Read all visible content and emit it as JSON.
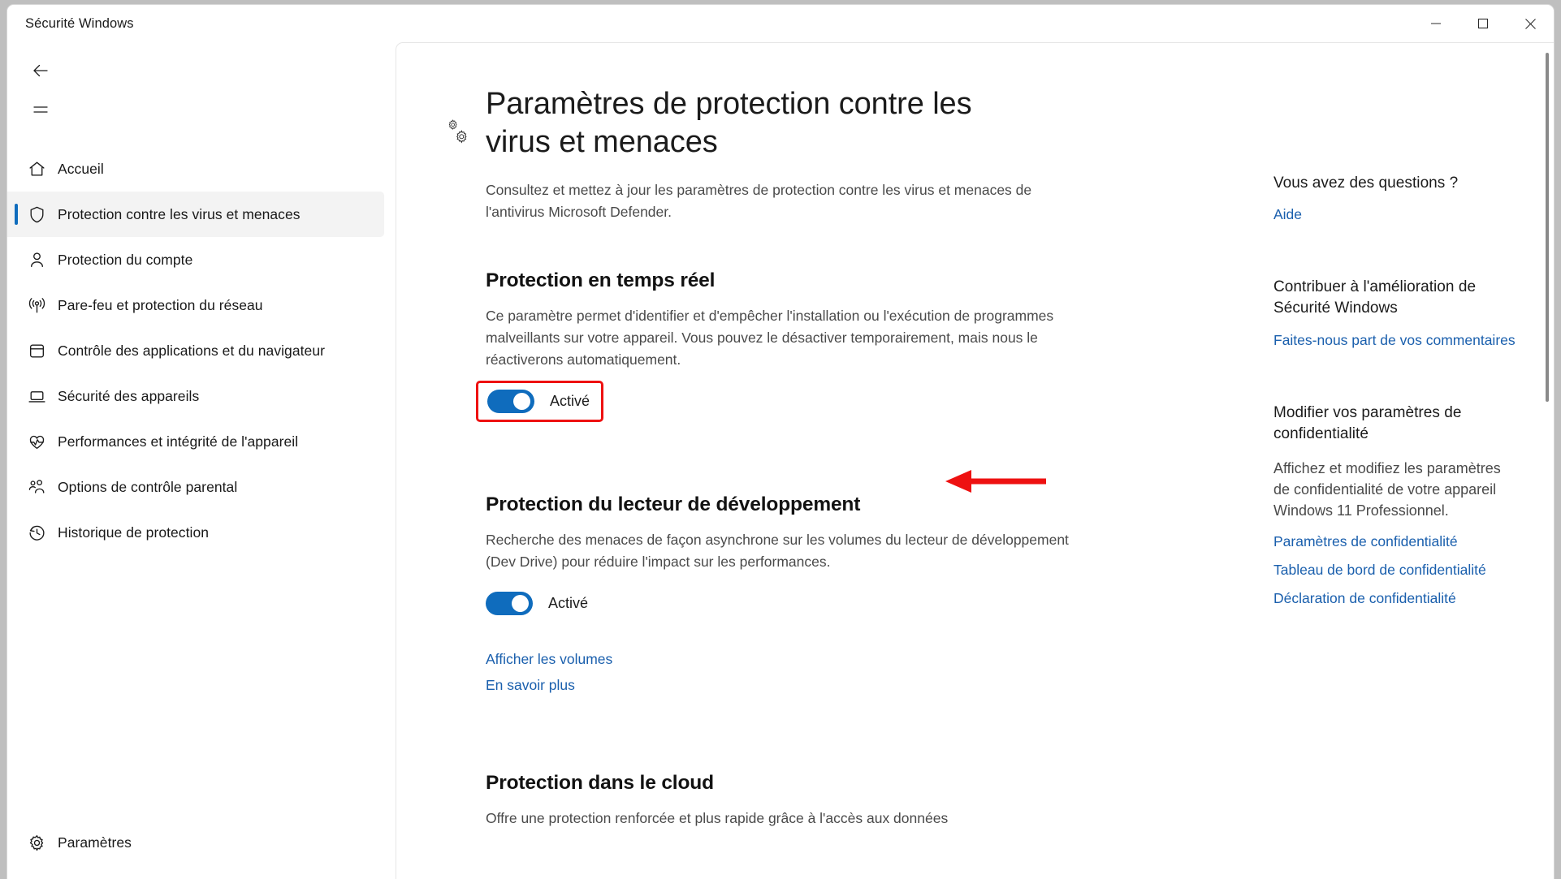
{
  "window": {
    "title": "Sécurité Windows",
    "controls": {
      "minimize": "Réduire",
      "maximize": "Agrandir",
      "close": "Fermer"
    }
  },
  "nav": {
    "back_label": "Précédent",
    "menu_label": "Menu de navigation",
    "items": [
      {
        "label": "Accueil",
        "icon": "home-icon",
        "selected": false
      },
      {
        "label": "Protection contre les virus et menaces",
        "icon": "shield-icon",
        "selected": true
      },
      {
        "label": "Protection du compte",
        "icon": "person-icon",
        "selected": false
      },
      {
        "label": "Pare-feu et protection du réseau",
        "icon": "wifi-icon",
        "selected": false
      },
      {
        "label": "Contrôle des applications et du navigateur",
        "icon": "app-window-icon",
        "selected": false
      },
      {
        "label": "Sécurité des appareils",
        "icon": "laptop-icon",
        "selected": false
      },
      {
        "label": "Performances et intégrité de l'appareil",
        "icon": "heart-pulse-icon",
        "selected": false
      },
      {
        "label": "Options de contrôle parental",
        "icon": "family-icon",
        "selected": false
      },
      {
        "label": "Historique de protection",
        "icon": "history-clock-icon",
        "selected": false
      }
    ],
    "settings": {
      "label": "Paramètres",
      "icon": "gear-icon"
    }
  },
  "page": {
    "icon": "double-gear-icon",
    "title": "Paramètres de protection contre les virus et menaces",
    "subtitle": "Consultez et mettez à jour les paramètres de protection contre les virus et menaces de l'antivirus Microsoft Defender."
  },
  "sections": {
    "realtime": {
      "title": "Protection en temps réel",
      "description": "Ce paramètre permet d'identifier et d'empêcher l'installation ou l'exécution de programmes malveillants sur votre appareil. Vous pouvez le désactiver temporairement, mais nous le réactiverons automatiquement.",
      "toggle_state": "Activé",
      "highlighted": true,
      "highlight_color": "#ee1111"
    },
    "devdrive": {
      "title": "Protection du lecteur de développement",
      "description": "Recherche des menaces de façon asynchrone sur les volumes du lecteur de développement (Dev Drive) pour réduire l'impact sur les performances.",
      "toggle_state": "Activé",
      "links": [
        "Afficher les volumes",
        "En savoir plus"
      ]
    },
    "cloud": {
      "title": "Protection dans le cloud",
      "description": "Offre une protection renforcée et plus rapide grâce à l'accès aux données"
    }
  },
  "right_rail": {
    "groups": [
      {
        "title": "Vous avez des questions ?",
        "text": "",
        "links": [
          "Aide"
        ]
      },
      {
        "title": "Contribuer à l'amélioration de Sécurité Windows",
        "text": "",
        "links": [
          "Faites-nous part de vos commentaires"
        ]
      },
      {
        "title": "Modifier vos paramètres de confidentialité",
        "text": "Affichez et modifiez les paramètres de confidentialité de votre appareil Windows 11 Professionnel.",
        "links": [
          "Paramètres de confidentialité",
          "Tableau de bord de confidentialité",
          "Déclaration de confidentialité"
        ]
      }
    ]
  },
  "colors": {
    "accent": "#0f6cbd",
    "link": "#1a5fad",
    "annotation": "#ee1111"
  },
  "scrollbar": {
    "label": "Barre de défilement verticale"
  }
}
